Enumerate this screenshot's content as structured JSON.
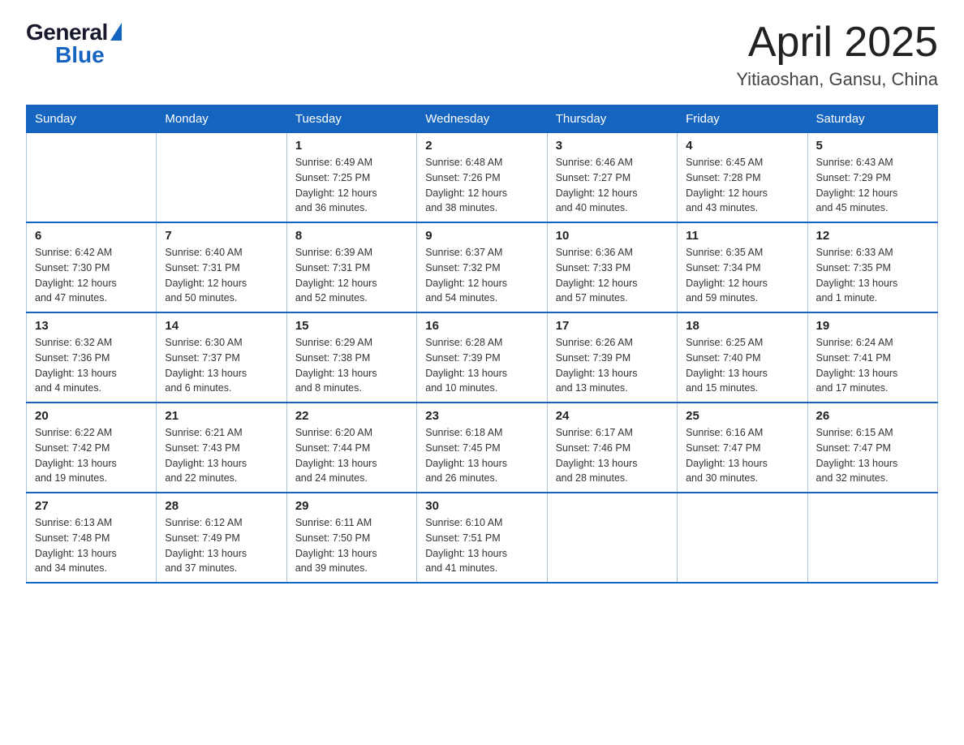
{
  "header": {
    "logo_general": "General",
    "logo_blue": "Blue",
    "month_title": "April 2025",
    "location": "Yitiaoshan, Gansu, China"
  },
  "weekdays": [
    "Sunday",
    "Monday",
    "Tuesday",
    "Wednesday",
    "Thursday",
    "Friday",
    "Saturday"
  ],
  "weeks": [
    [
      {
        "day": "",
        "info": ""
      },
      {
        "day": "",
        "info": ""
      },
      {
        "day": "1",
        "info": "Sunrise: 6:49 AM\nSunset: 7:25 PM\nDaylight: 12 hours\nand 36 minutes."
      },
      {
        "day": "2",
        "info": "Sunrise: 6:48 AM\nSunset: 7:26 PM\nDaylight: 12 hours\nand 38 minutes."
      },
      {
        "day": "3",
        "info": "Sunrise: 6:46 AM\nSunset: 7:27 PM\nDaylight: 12 hours\nand 40 minutes."
      },
      {
        "day": "4",
        "info": "Sunrise: 6:45 AM\nSunset: 7:28 PM\nDaylight: 12 hours\nand 43 minutes."
      },
      {
        "day": "5",
        "info": "Sunrise: 6:43 AM\nSunset: 7:29 PM\nDaylight: 12 hours\nand 45 minutes."
      }
    ],
    [
      {
        "day": "6",
        "info": "Sunrise: 6:42 AM\nSunset: 7:30 PM\nDaylight: 12 hours\nand 47 minutes."
      },
      {
        "day": "7",
        "info": "Sunrise: 6:40 AM\nSunset: 7:31 PM\nDaylight: 12 hours\nand 50 minutes."
      },
      {
        "day": "8",
        "info": "Sunrise: 6:39 AM\nSunset: 7:31 PM\nDaylight: 12 hours\nand 52 minutes."
      },
      {
        "day": "9",
        "info": "Sunrise: 6:37 AM\nSunset: 7:32 PM\nDaylight: 12 hours\nand 54 minutes."
      },
      {
        "day": "10",
        "info": "Sunrise: 6:36 AM\nSunset: 7:33 PM\nDaylight: 12 hours\nand 57 minutes."
      },
      {
        "day": "11",
        "info": "Sunrise: 6:35 AM\nSunset: 7:34 PM\nDaylight: 12 hours\nand 59 minutes."
      },
      {
        "day": "12",
        "info": "Sunrise: 6:33 AM\nSunset: 7:35 PM\nDaylight: 13 hours\nand 1 minute."
      }
    ],
    [
      {
        "day": "13",
        "info": "Sunrise: 6:32 AM\nSunset: 7:36 PM\nDaylight: 13 hours\nand 4 minutes."
      },
      {
        "day": "14",
        "info": "Sunrise: 6:30 AM\nSunset: 7:37 PM\nDaylight: 13 hours\nand 6 minutes."
      },
      {
        "day": "15",
        "info": "Sunrise: 6:29 AM\nSunset: 7:38 PM\nDaylight: 13 hours\nand 8 minutes."
      },
      {
        "day": "16",
        "info": "Sunrise: 6:28 AM\nSunset: 7:39 PM\nDaylight: 13 hours\nand 10 minutes."
      },
      {
        "day": "17",
        "info": "Sunrise: 6:26 AM\nSunset: 7:39 PM\nDaylight: 13 hours\nand 13 minutes."
      },
      {
        "day": "18",
        "info": "Sunrise: 6:25 AM\nSunset: 7:40 PM\nDaylight: 13 hours\nand 15 minutes."
      },
      {
        "day": "19",
        "info": "Sunrise: 6:24 AM\nSunset: 7:41 PM\nDaylight: 13 hours\nand 17 minutes."
      }
    ],
    [
      {
        "day": "20",
        "info": "Sunrise: 6:22 AM\nSunset: 7:42 PM\nDaylight: 13 hours\nand 19 minutes."
      },
      {
        "day": "21",
        "info": "Sunrise: 6:21 AM\nSunset: 7:43 PM\nDaylight: 13 hours\nand 22 minutes."
      },
      {
        "day": "22",
        "info": "Sunrise: 6:20 AM\nSunset: 7:44 PM\nDaylight: 13 hours\nand 24 minutes."
      },
      {
        "day": "23",
        "info": "Sunrise: 6:18 AM\nSunset: 7:45 PM\nDaylight: 13 hours\nand 26 minutes."
      },
      {
        "day": "24",
        "info": "Sunrise: 6:17 AM\nSunset: 7:46 PM\nDaylight: 13 hours\nand 28 minutes."
      },
      {
        "day": "25",
        "info": "Sunrise: 6:16 AM\nSunset: 7:47 PM\nDaylight: 13 hours\nand 30 minutes."
      },
      {
        "day": "26",
        "info": "Sunrise: 6:15 AM\nSunset: 7:47 PM\nDaylight: 13 hours\nand 32 minutes."
      }
    ],
    [
      {
        "day": "27",
        "info": "Sunrise: 6:13 AM\nSunset: 7:48 PM\nDaylight: 13 hours\nand 34 minutes."
      },
      {
        "day": "28",
        "info": "Sunrise: 6:12 AM\nSunset: 7:49 PM\nDaylight: 13 hours\nand 37 minutes."
      },
      {
        "day": "29",
        "info": "Sunrise: 6:11 AM\nSunset: 7:50 PM\nDaylight: 13 hours\nand 39 minutes."
      },
      {
        "day": "30",
        "info": "Sunrise: 6:10 AM\nSunset: 7:51 PM\nDaylight: 13 hours\nand 41 minutes."
      },
      {
        "day": "",
        "info": ""
      },
      {
        "day": "",
        "info": ""
      },
      {
        "day": "",
        "info": ""
      }
    ]
  ]
}
